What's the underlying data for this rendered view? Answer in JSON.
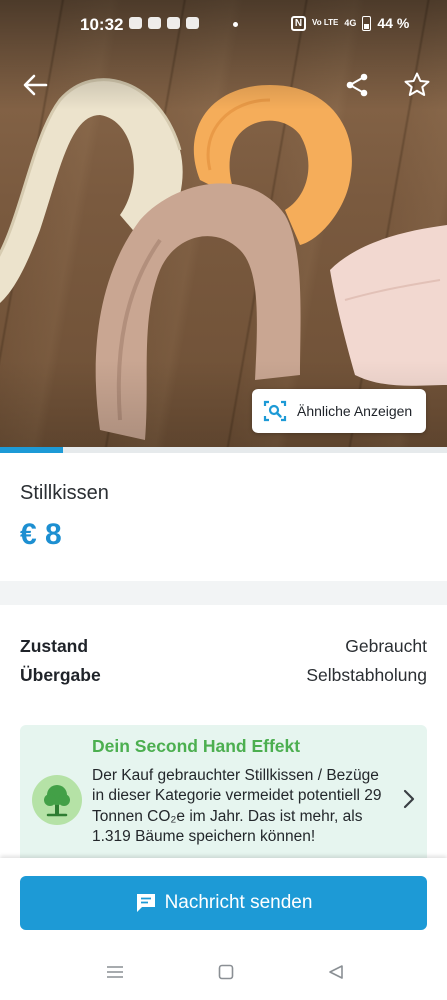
{
  "status_bar": {
    "time": "10:32",
    "battery_percent": "44 %",
    "network": "4G",
    "volte": "Vo LTE"
  },
  "gallery": {
    "similar_ads_label": "Ähnliche Anzeigen",
    "icons": {
      "back": "arrow-left-icon",
      "share": "share-icon",
      "favorite": "star-outline-icon",
      "similar": "image-search-icon"
    },
    "progress_fraction": 0.14
  },
  "listing": {
    "title": "Stillkissen",
    "price": "€ 8"
  },
  "details": [
    {
      "key": "Zustand",
      "value": "Gebraucht"
    },
    {
      "key": "Übergabe",
      "value": "Selbstabholung"
    }
  ],
  "second_hand": {
    "heading": "Dein Second Hand Effekt",
    "body": "Der Kauf gebrauchter Stillkissen / Bezüge in dieser Kategorie vermeidet potentiell 29 Tonnen CO₂e im Jahr. Das ist mehr, als 1.319 Bäume speichern können!",
    "icon": "tree-icon"
  },
  "cta": {
    "send_message_label": "Nachricht senden",
    "icon": "message-icon"
  },
  "colors": {
    "accent": "#1d9ad6",
    "price": "#1d8fd1",
    "green_heading": "#4caf50",
    "card_bg": "#e6f5ef"
  }
}
